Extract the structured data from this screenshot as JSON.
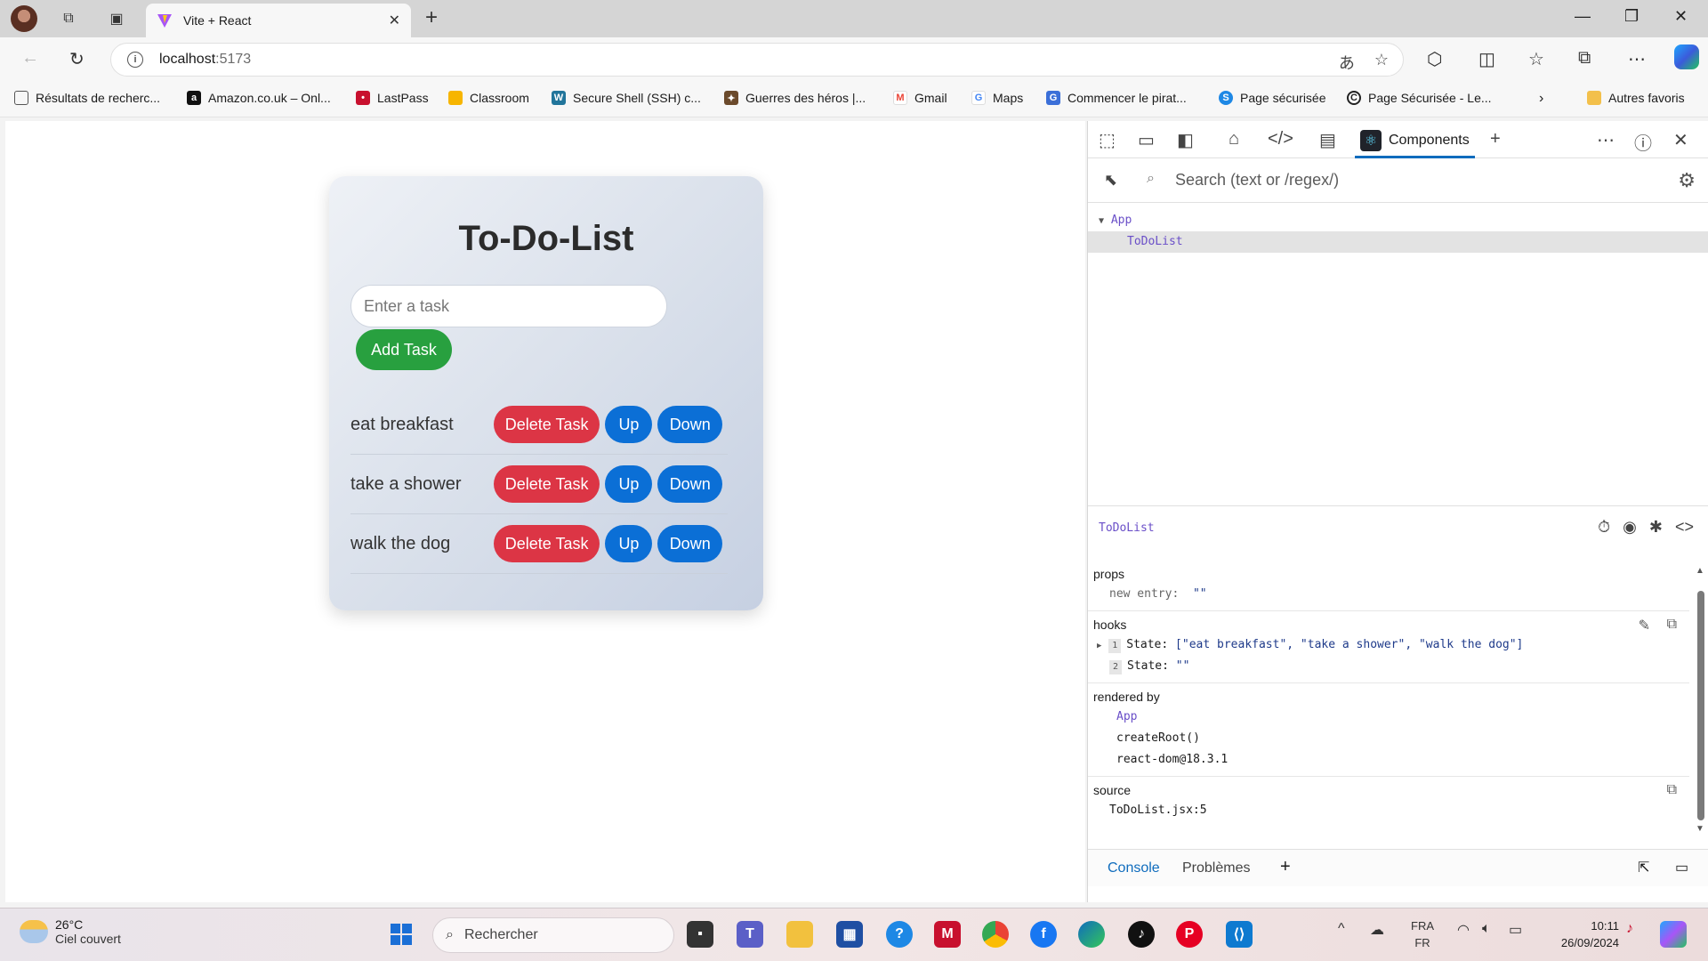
{
  "browser": {
    "tab_title": "Vite + React",
    "url_host": "localhost",
    "url_port": ":5173"
  },
  "bookmarks": [
    {
      "label": "Résultats de recherc...",
      "color": "#ffffff"
    },
    {
      "label": "Amazon.co.uk – Onl...",
      "color": "#111111"
    },
    {
      "label": "LastPass",
      "color": "#c8102e"
    },
    {
      "label": "Classroom",
      "color": "#f7b500"
    },
    {
      "label": "Secure Shell (SSH) c...",
      "color": "#21759b"
    },
    {
      "label": "Guerres des héros |...",
      "color": "#6b4a2b"
    },
    {
      "label": "Gmail",
      "color": "#ea4335"
    },
    {
      "label": "Maps",
      "color": "#4285f4"
    },
    {
      "label": "Commencer le pirat...",
      "color": "#3b6fd8"
    },
    {
      "label": "Page sécurisée",
      "color": "#1e88e5"
    },
    {
      "label": "Page Sécurisée - Le...",
      "color": "#222222"
    }
  ],
  "other_favorites": "Autres favoris",
  "app": {
    "title": "To-Do-List",
    "input_placeholder": "Enter a task",
    "add_label": "Add Task",
    "delete_label": "Delete Task",
    "up_label": "Up",
    "down_label": "Down",
    "tasks": [
      "eat breakfast",
      "take a shower",
      "walk the dog"
    ]
  },
  "devtools": {
    "active_tab": "Components",
    "search_placeholder": "Search (text or /regex/)",
    "tree": [
      {
        "label": "App",
        "level": 0
      },
      {
        "label": "ToDoList",
        "level": 1
      }
    ],
    "selected_component": "ToDoList",
    "props_title": "props",
    "props_key": "new entry:",
    "props_value": "\"\"",
    "hooks_title": "hooks",
    "hooks": [
      {
        "index": "1",
        "key": "State:",
        "value": "[\"eat breakfast\", \"take a shower\", \"walk the dog\"]"
      },
      {
        "index": "2",
        "key": "State:",
        "value": "\"\""
      }
    ],
    "rendered_by_title": "rendered by",
    "rendered_by": [
      "App",
      "createRoot()",
      "react-dom@18.3.1"
    ],
    "source_title": "source",
    "source_value": "ToDoList.jsx:5",
    "drawer_tabs": [
      "Console",
      "Problèmes"
    ]
  },
  "taskbar": {
    "temperature": "26°C",
    "weather": "Ciel couvert",
    "search_placeholder": "Rechercher",
    "lang_1": "FRA",
    "lang_2": "FR",
    "time": "10:11",
    "date": "26/09/2024"
  },
  "colors": {
    "add_button": "#28a03f",
    "delete_button": "#dc3545",
    "move_button": "#0b6fd6",
    "accent": "#0f6cbd"
  }
}
